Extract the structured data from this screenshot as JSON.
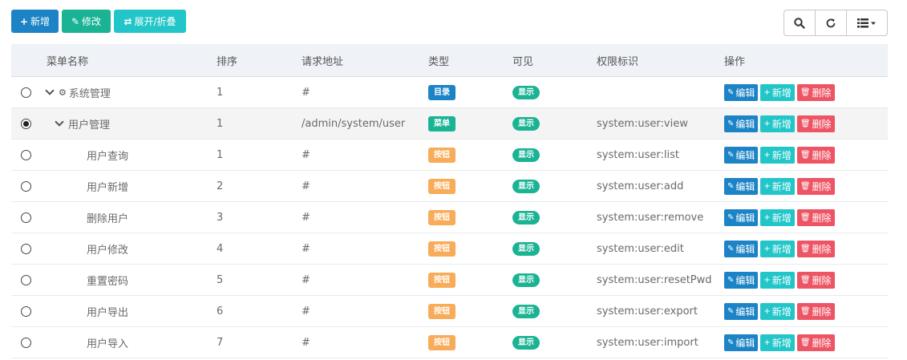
{
  "toolbar": {
    "add_label": "新增",
    "edit_label": "修改",
    "expand_label": "展开/折叠"
  },
  "header": {
    "name": "菜单名称",
    "sort": "排序",
    "url": "请求地址",
    "type": "类型",
    "visible": "可见",
    "perm": "权限标识",
    "ops": "操作"
  },
  "ops": {
    "edit": "编辑",
    "add": "新增",
    "del": "删除"
  },
  "rows": [
    {
      "name": "系统管理",
      "sort": "1",
      "url": "#",
      "type": "目录",
      "visible": "显示",
      "perm": ""
    },
    {
      "name": "用户管理",
      "sort": "1",
      "url": "/admin/system/user",
      "type": "菜单",
      "visible": "显示",
      "perm": "system:user:view"
    },
    {
      "name": "用户查询",
      "sort": "1",
      "url": "#",
      "type": "按钮",
      "visible": "显示",
      "perm": "system:user:list"
    },
    {
      "name": "用户新增",
      "sort": "2",
      "url": "#",
      "type": "按钮",
      "visible": "显示",
      "perm": "system:user:add"
    },
    {
      "name": "删除用户",
      "sort": "3",
      "url": "#",
      "type": "按钮",
      "visible": "显示",
      "perm": "system:user:remove"
    },
    {
      "name": "用户修改",
      "sort": "4",
      "url": "#",
      "type": "按钮",
      "visible": "显示",
      "perm": "system:user:edit"
    },
    {
      "name": "重置密码",
      "sort": "5",
      "url": "#",
      "type": "按钮",
      "visible": "显示",
      "perm": "system:user:resetPwd"
    },
    {
      "name": "用户导出",
      "sort": "6",
      "url": "#",
      "type": "按钮",
      "visible": "显示",
      "perm": "system:user:export"
    },
    {
      "name": "用户导入",
      "sort": "7",
      "url": "#",
      "type": "按钮",
      "visible": "显示",
      "perm": "system:user:import"
    }
  ],
  "colors": {
    "primary": "#1c84c6",
    "success": "#1ab394",
    "info": "#23c6c8",
    "warning": "#f8ac59",
    "danger": "#ed5565"
  }
}
